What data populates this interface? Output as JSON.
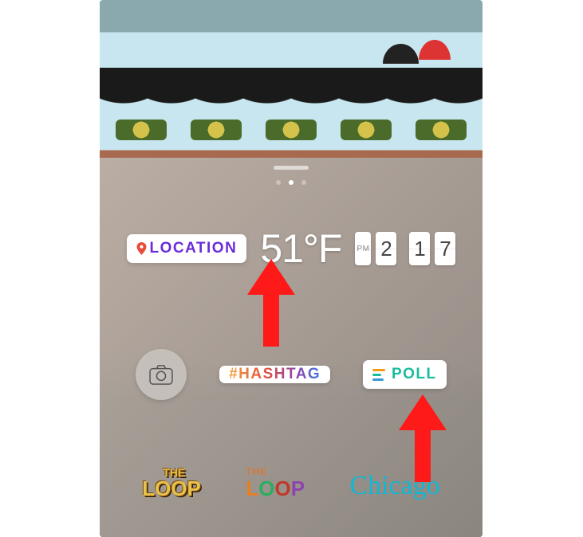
{
  "panel": {
    "page_indicator": {
      "count": 3,
      "active_index": 1
    }
  },
  "stickers": {
    "location": {
      "label": "LOCATION"
    },
    "temperature": {
      "display": "51°F"
    },
    "clock": {
      "period": "PM",
      "h1": "2",
      "m1": "1",
      "m2": "7"
    },
    "hashtag": {
      "label": "#HASHTAG"
    },
    "poll": {
      "label": "POLL"
    }
  },
  "location_gifs": {
    "loop_gold": {
      "small": "THE",
      "big": "LOOP"
    },
    "loop_color": {
      "small": "THE",
      "big": "LOOP"
    },
    "chicago": {
      "text": "Chicago"
    }
  }
}
